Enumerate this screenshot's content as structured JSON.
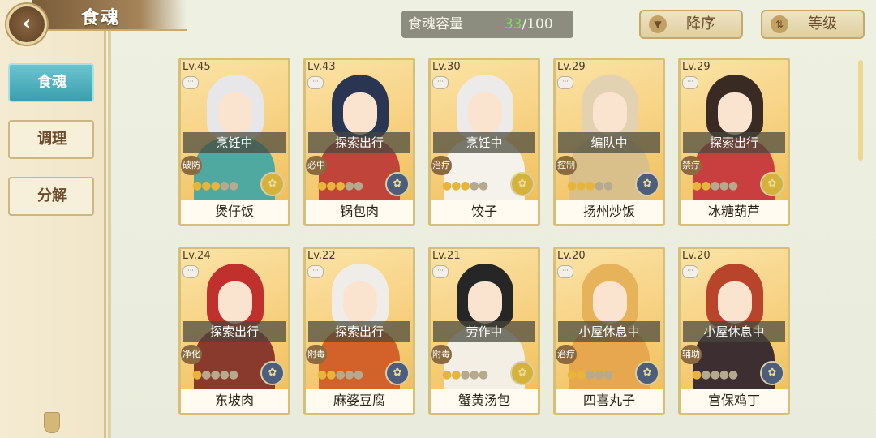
{
  "header": {
    "title": "食魂",
    "back_icon": "‹",
    "capacity_label": "食魂容量",
    "capacity_current": "33",
    "capacity_max": "/100"
  },
  "sort": {
    "order_label": "降序",
    "order_icon": "▼",
    "level_label": "等级",
    "level_icon": "⇅"
  },
  "sidebar": {
    "items": [
      {
        "label": "食魂",
        "active": true
      },
      {
        "label": "调理",
        "active": false
      },
      {
        "label": "分解",
        "active": false
      }
    ]
  },
  "cards": [
    {
      "level": "Lv.45",
      "status": "烹饪中",
      "role": "破防",
      "stars": 3,
      "name": "煲仔饭",
      "skill_color": "#d7b23a",
      "hair": "#e7e7ea",
      "robe": "#4fa9a1"
    },
    {
      "level": "Lv.43",
      "status": "探索出行",
      "role": "必中",
      "stars": 3,
      "name": "锅包肉",
      "skill_color": "#4d5e7c",
      "hair": "#2a3552",
      "robe": "#c0443a"
    },
    {
      "level": "Lv.30",
      "status": "烹饪中",
      "role": "治疗",
      "stars": 3,
      "name": "饺子",
      "skill_color": "#d7b23a",
      "hair": "#ecebea",
      "robe": "#f4f2ea"
    },
    {
      "level": "Lv.29",
      "status": "编队中",
      "role": "控制",
      "stars": 3,
      "name": "扬州炒饭",
      "skill_color": "#4d5e7c",
      "hair": "#e3d2b2",
      "robe": "#d9c08a"
    },
    {
      "level": "Lv.29",
      "status": "探索出行",
      "role": "禁疗",
      "stars": 2,
      "name": "冰糖葫芦",
      "skill_color": "#d7b23a",
      "hair": "#3a2a24",
      "robe": "#c93f3f"
    },
    {
      "level": "Lv.24",
      "status": "探索出行",
      "role": "净化",
      "stars": 1,
      "name": "东坡肉",
      "skill_color": "#4d5e7c",
      "hair": "#c0302c",
      "robe": "#8a3a2c"
    },
    {
      "level": "Lv.22",
      "status": "探索出行",
      "role": "附毒",
      "stars": 2,
      "name": "麻婆豆腐",
      "skill_color": "#4d5e7c",
      "hair": "#f0ede8",
      "robe": "#d2622a"
    },
    {
      "level": "Lv.21",
      "status": "劳作中",
      "role": "附毒",
      "stars": 2,
      "name": "蟹黄汤包",
      "skill_color": "#d7b23a",
      "hair": "#262626",
      "robe": "#f4efe4"
    },
    {
      "level": "Lv.20",
      "status": "小屋休息中",
      "role": "治疗",
      "stars": 2,
      "name": "四喜丸子",
      "skill_color": "#4d5e7c",
      "hair": "#e6b35a",
      "robe": "#e7a74f"
    },
    {
      "level": "Lv.20",
      "status": "小屋休息中",
      "role": "辅助",
      "stars": 1,
      "name": "宫保鸡丁",
      "skill_color": "#4d5e7c",
      "hair": "#b8452b",
      "robe": "#3d2e32"
    }
  ],
  "icons": {
    "star_on": "●",
    "star_off": "●",
    "skill": "✿",
    "dialog": "···"
  },
  "colors": {
    "active_tab": "#3c9fae",
    "capacity_current": "#7ddb5a",
    "card_border": "#d7bf77"
  }
}
